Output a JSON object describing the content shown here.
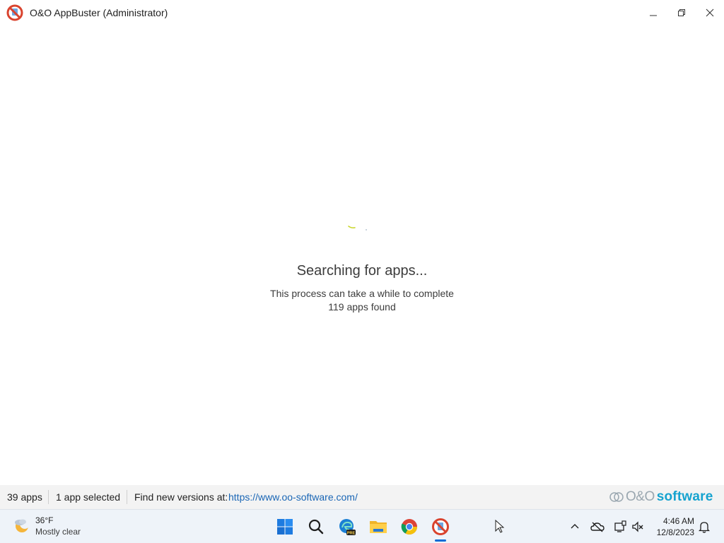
{
  "window": {
    "title": "O&O AppBuster (Administrator)",
    "icon": "no-entry-icon"
  },
  "main": {
    "heading": "Searching for apps...",
    "subtext": "This process can take a while to complete",
    "count_text": "119 apps found"
  },
  "status_bar": {
    "apps_count": "39 apps",
    "selected": "1 app selected",
    "find_label": "Find new versions at:",
    "link": "https://www.oo-software.com/",
    "brand_oo": "O&O",
    "brand_software": "software"
  },
  "taskbar": {
    "weather": {
      "temp": "36°F",
      "desc": "Mostly clear",
      "icon": "moon-cloud-icon"
    },
    "apps": [
      {
        "name": "Start",
        "icon": "windows-start-icon"
      },
      {
        "name": "Search",
        "icon": "search-icon"
      },
      {
        "name": "Microsoft Edge Preview",
        "icon": "edge-preview-icon"
      },
      {
        "name": "File Explorer",
        "icon": "folder-icon"
      },
      {
        "name": "Google Chrome",
        "icon": "chrome-icon"
      },
      {
        "name": "O&O AppBuster",
        "icon": "no-entry-icon",
        "active": true
      }
    ],
    "tray": [
      "chevron-up-icon",
      "cloud-offline-icon",
      "network-icon",
      "volume-muted-icon"
    ],
    "time": "4:46 AM",
    "date": "12/8/2023",
    "notification_icon": "bell-icon"
  },
  "colors": {
    "accent": "#0a6cd6",
    "link": "#1a66b5",
    "brand_blue": "#16a3cf",
    "brand_gray": "#9aa7b0",
    "app_icon_red": "#d9432e"
  }
}
